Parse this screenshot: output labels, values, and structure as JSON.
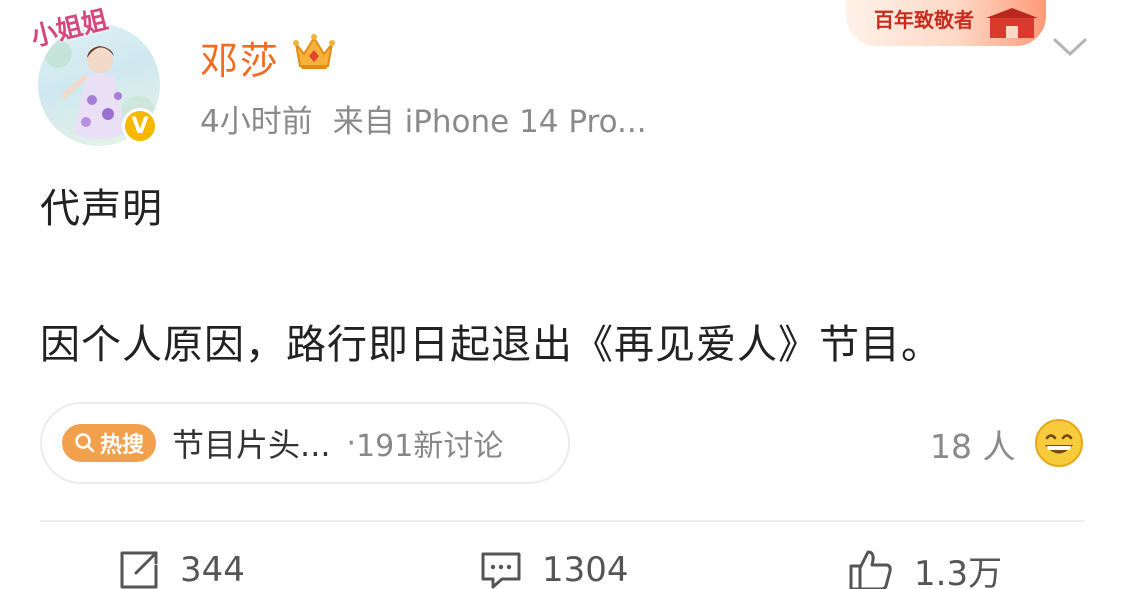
{
  "header": {
    "avatar_label": "小姐姐",
    "verified_badge": "V",
    "username": "邓莎",
    "timestamp": "4小时前",
    "source": "来自 iPhone 14 Pro...",
    "banner_text": "百年致敬者",
    "crown_icon": "vip-crown-icon",
    "chevron_icon": "chevron-down-icon"
  },
  "post": {
    "line1": "代声明",
    "line2": "因个人原因，路行即日起退出《再见爱人》节目。"
  },
  "hot_search": {
    "badge": "热搜",
    "topic": "节目片头...",
    "separator": "·",
    "count": "191新讨论"
  },
  "reactions": {
    "count": "18 人",
    "emoji_icon": "grinning-emoji-icon"
  },
  "actions": {
    "share_count": "344",
    "comment_count": "1304",
    "like_count": "1.3万"
  },
  "colors": {
    "username": "#f26b21",
    "meta": "#8a8a8a",
    "hot_badge": "#f3a04c",
    "verified": "#f6b800"
  }
}
